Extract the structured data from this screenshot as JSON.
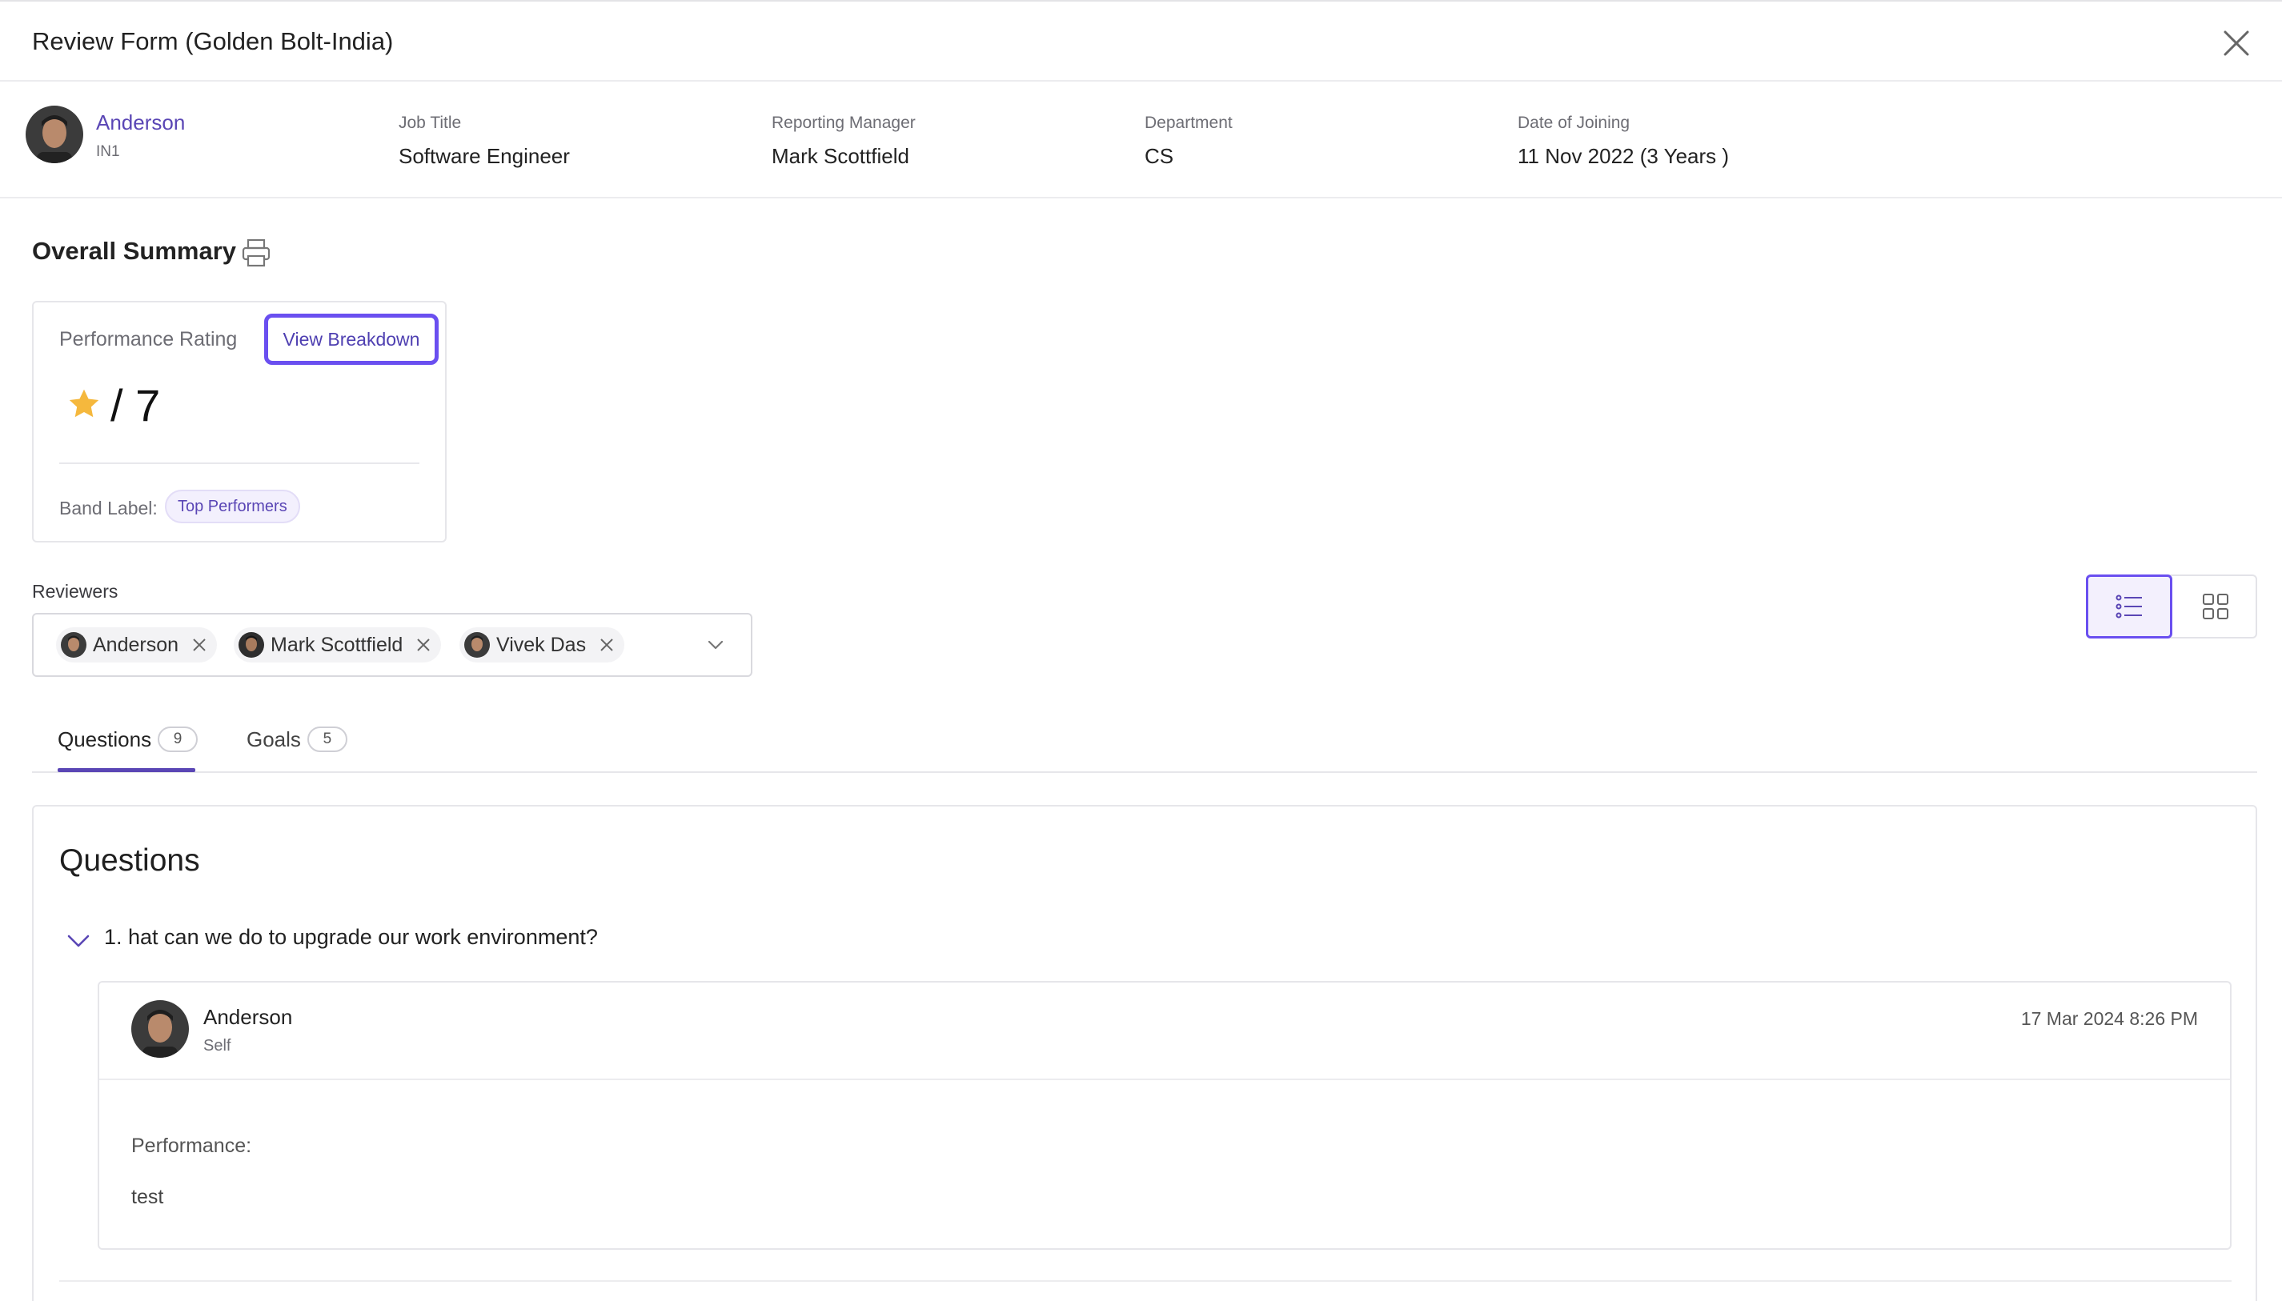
{
  "header": {
    "title": "Review Form (Golden Bolt-India)"
  },
  "employee": {
    "name": "Anderson",
    "code": "IN1",
    "fields": [
      {
        "label": "Job Title",
        "value": "Software Engineer"
      },
      {
        "label": "Reporting Manager",
        "value": "Mark Scottfield"
      },
      {
        "label": "Department",
        "value": "CS"
      },
      {
        "label": "Date of Joining",
        "value": "11 Nov 2022 (3 Years )"
      }
    ]
  },
  "summary": {
    "title": "Overall Summary",
    "rating_label": "Performance Rating",
    "view_breakdown": "View Breakdown",
    "rating_value": "/ 7",
    "band_label": "Band Label:",
    "band_value": "Top Performers"
  },
  "reviewers": {
    "label": "Reviewers",
    "chips": [
      "Anderson",
      "Mark Scottfield",
      "Vivek Das"
    ]
  },
  "tabs": [
    {
      "label": "Questions",
      "count": "9",
      "active": true
    },
    {
      "label": "Goals",
      "count": "5",
      "active": false
    }
  ],
  "questions": {
    "title": "Questions",
    "items": [
      {
        "text": "1. hat can we do to upgrade our work environment?",
        "answer": {
          "name": "Anderson",
          "role": "Self",
          "date": "17 Mar 2024 8:26 PM",
          "label": "Performance:",
          "value": "test"
        }
      }
    ]
  },
  "colors": {
    "accent": "#5a46b5",
    "focus_ring": "#6a4ff0",
    "star": "#f5b83d"
  },
  "icons": {
    "close": "close-icon",
    "print": "printer-icon",
    "star": "star-icon",
    "chevron": "chevron-down-icon",
    "list_view": "list-view-icon",
    "grid_view": "grid-view-icon"
  }
}
